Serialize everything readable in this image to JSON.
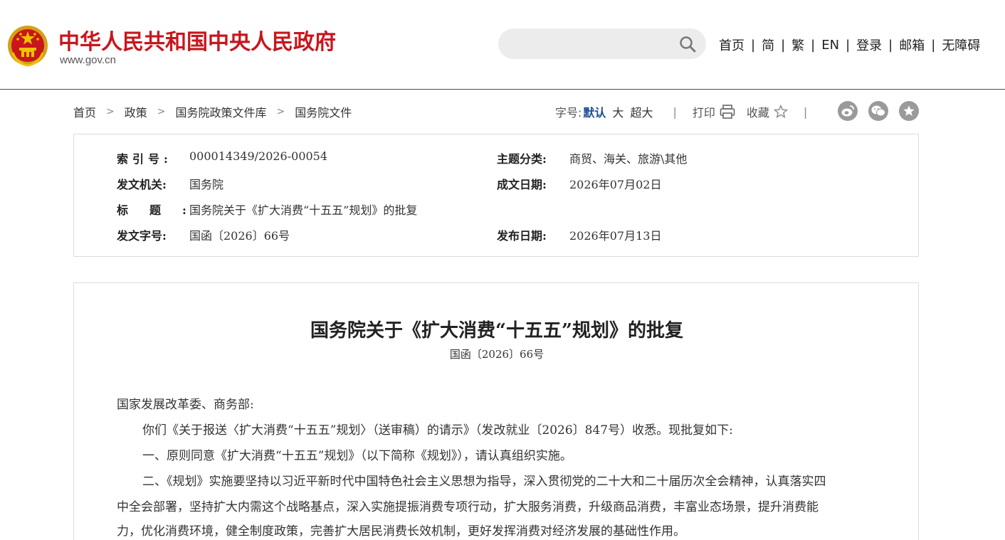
{
  "header": {
    "site_title": "中华人民共和国中央人民政府",
    "site_url": "www.gov.cn",
    "search_placeholder": "",
    "nav": [
      "首页",
      "简",
      "繁",
      "EN",
      "登录",
      "邮箱",
      "无障碍"
    ]
  },
  "breadcrumb": [
    "首页",
    "政策",
    "国务院政策文件库",
    "国务院文件"
  ],
  "tools": {
    "font_size_label": "字号:",
    "font_sizes": [
      "默认",
      "大",
      "超大"
    ],
    "print_label": "打印",
    "favorite_label": "收藏"
  },
  "info": {
    "index_label": "索引号:",
    "index_value": "000014349/2026-00054",
    "topic_label": "主题分类:",
    "topic_value": "商贸、海关、旅游\\其他",
    "issuer_label": "发文机关:",
    "issuer_value": "国务院",
    "written_date_label": "成文日期:",
    "written_date_value": "2026年07月02日",
    "title_label": "标题:",
    "title_value": "国务院关于《扩大消费“十五五”规划》的批复",
    "doc_no_label": "发文字号:",
    "doc_no_value": "国函〔2026〕66号",
    "publish_date_label": "发布日期:",
    "publish_date_value": "2026年07月13日"
  },
  "document": {
    "title": "国务院关于《扩大消费“十五五”规划》的批复",
    "number": "国函〔2026〕66号",
    "addressee": "国家发展改革委、商务部:",
    "p1": "你们《关于报送〈扩大消费“十五五”规划〉（送审稿）的请示》（发改就业〔2026〕847号）收悉。现批复如下:",
    "p2": "一、原则同意《扩大消费“十五五”规划》（以下简称《规划》），请认真组织实施。",
    "p3_line1": "二、《规划》实施要坚持以习近平新时代中国特色社会主义思想为指导，深入贯彻党的二十大和二十届历次全会精神，认真落实四",
    "p3_line2": "中全会部署，坚持扩大内需这个战略基点，深入实施提振消费专项行动，扩大服务消费，升级商品消费，丰富业态场景，提升消费能",
    "p3_line3": "力，优化消费环境，健全制度政策，完善扩大居民消费长效机制，更好发挥消费对经济发展的基础性作用。"
  },
  "colors": {
    "brand_red": "#c8161d",
    "link_blue": "#1d4f91",
    "share_gray": "#9a9a9a"
  },
  "icons": [
    "national-emblem-icon",
    "search-icon",
    "printer-icon",
    "star-icon",
    "weibo-icon",
    "wechat-icon",
    "favorite-share-icon"
  ]
}
